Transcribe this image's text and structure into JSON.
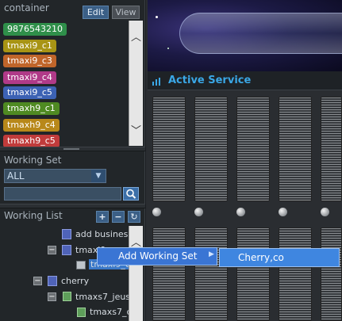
{
  "container": {
    "title": "container",
    "edit_label": "Edit",
    "view_label": "View",
    "items": [
      {
        "label": "9876543210",
        "color": "#2f8f4a"
      },
      {
        "label": "tmaxi9_c1",
        "color": "#a89414"
      },
      {
        "label": "tmaxi9_c3",
        "color": "#c0652a"
      },
      {
        "label": "tmaxi9_c4",
        "color": "#b03a88"
      },
      {
        "label": "tmaxi9_c5",
        "color": "#3c62b4"
      },
      {
        "label": "tmaxh9_c1",
        "color": "#4f8a22"
      },
      {
        "label": "tmaxh9_c4",
        "color": "#b8881a"
      },
      {
        "label": "tmaxh9_c5",
        "color": "#c03b3b"
      }
    ]
  },
  "working_set": {
    "title": "Working Set",
    "selected": "ALL",
    "search_value": ""
  },
  "working_list": {
    "title": "Working List",
    "items": [
      {
        "label": "add busines"
      },
      {
        "label": "tmaxi9"
      },
      {
        "label": "tmaxi9_c"
      },
      {
        "label": "cherry"
      },
      {
        "label": "tmaxs7_jeus"
      },
      {
        "label": "tmaxs7_c"
      }
    ]
  },
  "right": {
    "title": "Active Service"
  },
  "context_menu": {
    "item_label": "Add Working Set",
    "submenu_label": "Cherry,co"
  }
}
